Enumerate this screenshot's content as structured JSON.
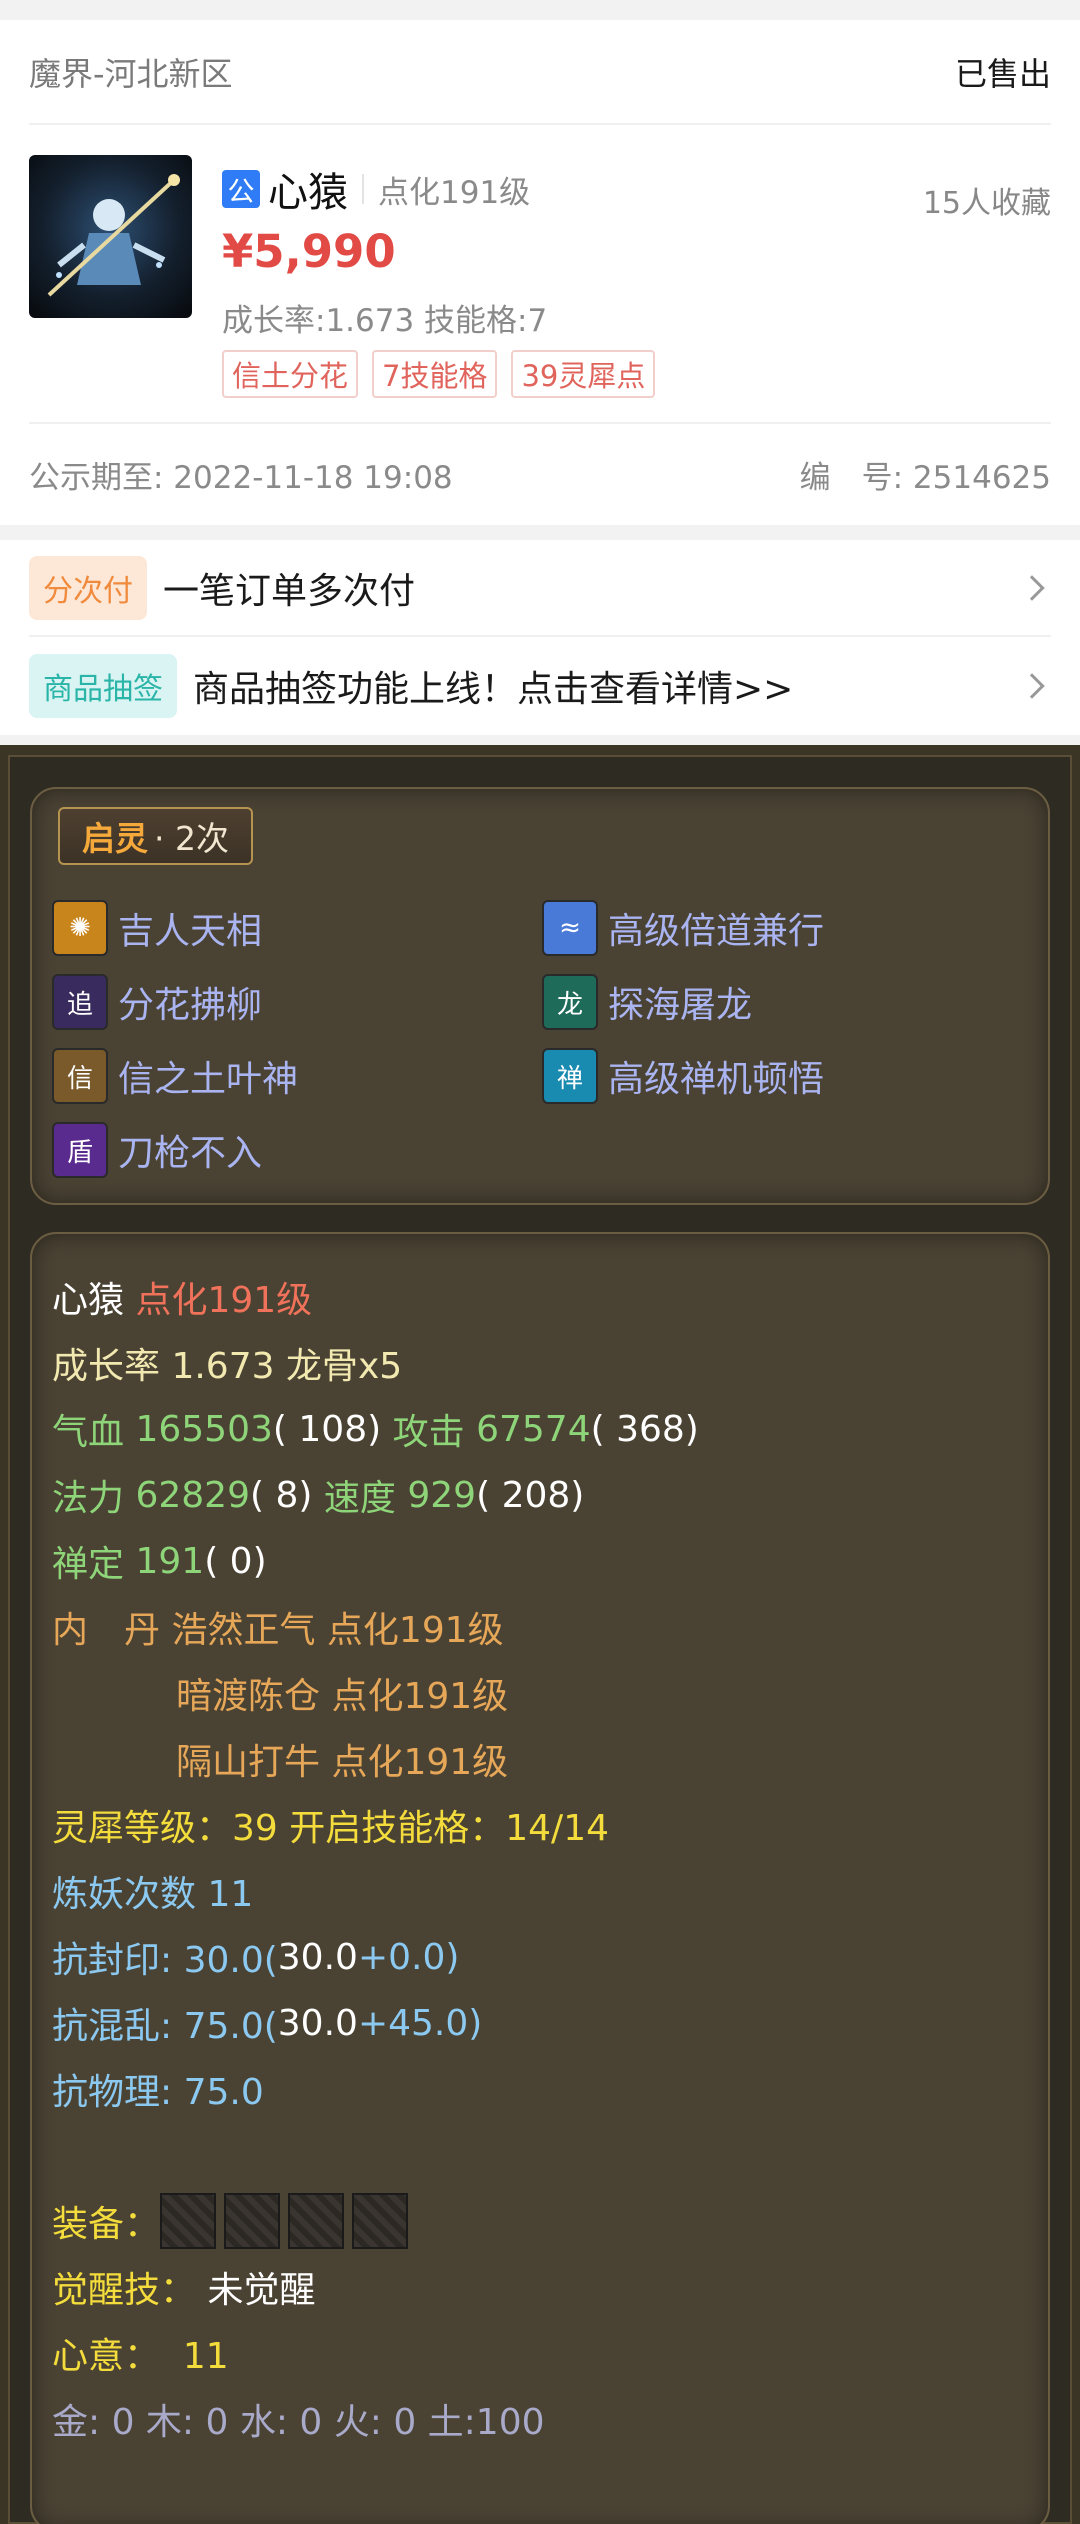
{
  "header": {
    "server": "魔界-河北新区",
    "status": "已售出"
  },
  "item": {
    "badge": "公",
    "name": "心猿",
    "level": "点化191级",
    "favorites": "15人收藏",
    "price": "¥5,990",
    "growth_line": "成长率:1.673 技能格:7",
    "tags": [
      "信土分花",
      "7技能格",
      "39灵犀点"
    ],
    "publicity": "公示期至: 2022-11-18 19:08",
    "serial": "编　号: 2514625"
  },
  "promos": [
    {
      "badge": "分次付",
      "text": "一笔订单多次付"
    },
    {
      "badge": "商品抽签",
      "text": "商品抽签功能上线！点击查看详情>>"
    }
  ],
  "qiling": {
    "label": "启灵",
    "count": "· 2次"
  },
  "skills": [
    {
      "name": "吉人天相",
      "icon": "golden-rays-icon",
      "glyph": "✺",
      "color": "#c8851c"
    },
    {
      "name": "高级倍道兼行",
      "icon": "wind-swirl-icon",
      "glyph": "≈",
      "color": "#4a7ad8"
    },
    {
      "name": "分花拂柳",
      "icon": "chase-icon",
      "glyph": "追",
      "color": "#3a2b5e"
    },
    {
      "name": "探海屠龙",
      "icon": "dragon-icon",
      "glyph": "龙",
      "color": "#1f6b5a"
    },
    {
      "name": "信之土叶神",
      "icon": "xin-seal-icon",
      "glyph": "信",
      "color": "#7a5a2a"
    },
    {
      "name": "高级禅机顿悟",
      "icon": "zen-icon",
      "glyph": "禅",
      "color": "#1a8bb0"
    },
    {
      "name": "刀枪不入",
      "icon": "shield-icon",
      "glyph": "盾",
      "color": "#5a2b8e"
    }
  ],
  "stats": {
    "name": "心猿",
    "level": "点化191级",
    "growth": "成长率 1.673 龙骨x5",
    "hp_label": "气血",
    "hp": "165503",
    "hp_add": "( 108)",
    "atk_label": "攻击",
    "atk": "67574",
    "atk_add": "( 368)",
    "mp_label": "法力",
    "mp": "62829",
    "mp_add": "( 8)",
    "spd_label": "速度",
    "spd": "929",
    "spd_add": "( 208)",
    "zen_label": "禅定",
    "zen": "191",
    "zen_add": "( 0)",
    "neidan_label": "内　丹",
    "neidan": [
      "浩然正气 点化191级",
      "暗渡陈仓 点化191级",
      "隔山打牛 点化191级"
    ],
    "lingxi": "灵犀等级：39 开启技能格：14/14",
    "lianyao": "炼妖次数 11",
    "res_seal_label": "抗封印: 30.0(",
    "res_seal_base": "30.0",
    "res_seal_add": "+0.0)",
    "res_chaos_label": "抗混乱: 75.0(",
    "res_chaos_base": "30.0",
    "res_chaos_add": "+45.0)",
    "res_phys": "抗物理: 75.0",
    "equip_label": "装备：",
    "awaken_label": "觉醒技：",
    "awaken_value": "未觉醒",
    "xinyi": "心意：  11",
    "elements": "金: 0 木: 0 水: 0 火: 0 土:100"
  }
}
